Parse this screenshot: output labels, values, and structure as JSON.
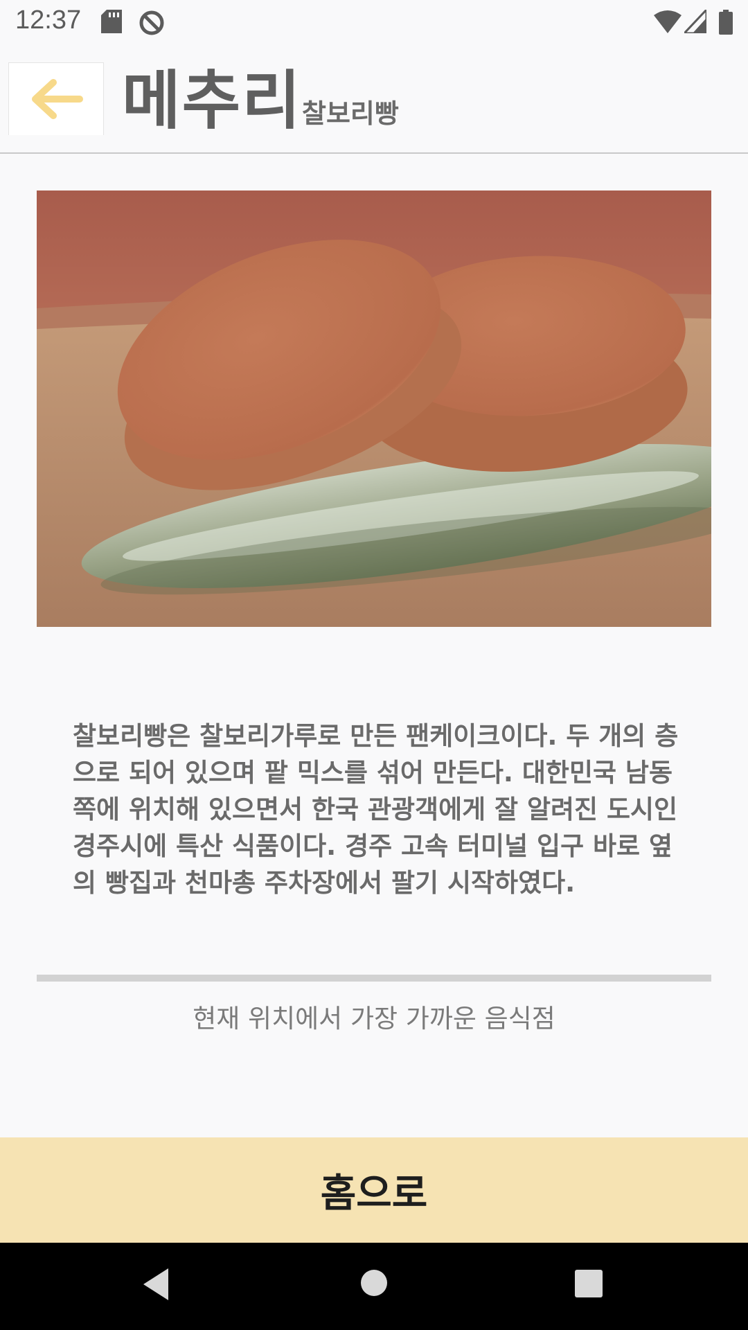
{
  "status_bar": {
    "time": "12:37",
    "icons": [
      "sd-card-icon",
      "sync-icon",
      "wifi-icon",
      "signal-icon",
      "battery-icon"
    ]
  },
  "header": {
    "back_icon": "back-arrow-icon",
    "title": "메추리",
    "subtitle": "찰보리빵"
  },
  "main": {
    "image_alt": "찰보리빵",
    "description": "찰보리빵은 찰보리가루로 만든 팬케이크이다. 두 개의 층으로 되어 있으며 팥 믹스를 섞어 만든다. 대한민국 남동쪽에 위치해 있으면서 한국 관광객에게 잘 알려진 도시인 경주시에 특산 식품이다. 경주 고속 터미널 입구 바로 옆의 빵집과 천마총 주차장에서 팔기 시작하였다.",
    "nearby_label": "현재 위치에서 가장 가까운 음식점"
  },
  "footer": {
    "home_label": "홈으로"
  },
  "nav_bar": {
    "icons": [
      "nav-back-icon",
      "nav-home-icon",
      "nav-recents-icon"
    ]
  },
  "colors": {
    "accent": "#f6e3b3",
    "back_arrow": "#f7d98a",
    "text": "#6a6a6a"
  }
}
